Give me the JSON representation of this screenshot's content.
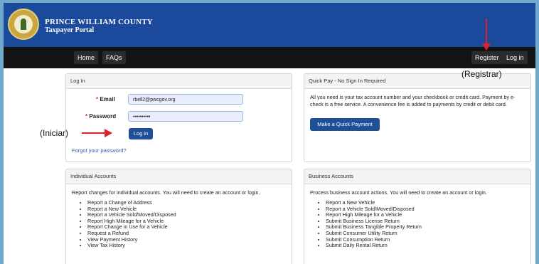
{
  "header": {
    "title_line1": "PRINCE WILLIAM COUNTY",
    "title_line2": "Taxpayer Portal"
  },
  "nav": {
    "home": "Home",
    "faqs": "FAQs",
    "register": "Register",
    "login": "Log in"
  },
  "login_panel": {
    "title": "Log In",
    "email_label": "Email",
    "email_value": "rbell2@pwcgov.org",
    "password_label": "Password",
    "password_value": "••••••••••",
    "login_button": "Log in",
    "forgot_link": "Forgot your password?"
  },
  "quickpay_panel": {
    "title": "Quick Pay - No Sign In Required",
    "description": "All you need is your tax account number and your checkbook or credit card. Payment by e-check is a free service. A convenience fee is added to payments by credit or debit card.",
    "button": "Make a Quick Payment"
  },
  "individual_panel": {
    "title": "Individual Accounts",
    "intro": "Report changes for individual accounts. You will need to create an account or login.",
    "items": [
      "Report a Change of Address",
      "Report a New Vehicle",
      "Report a Vehicle Sold/Moved/Disposed",
      "Report High Mileage for a Vehicle",
      "Report Change in Use for a Vehicle",
      "Request a Refund",
      "View Payment History",
      "View Tax History"
    ]
  },
  "business_panel": {
    "title": "Business Accounts",
    "intro": "Process business account actions. You will need to create an account or login.",
    "items": [
      "Report a New Vehicle",
      "Report a Vehicle Sold/Moved/Disposed",
      "Report High Mileage for a Vehicle",
      "Submit Business License Return",
      "Submit Business Tangible Property Return",
      "Submit Consumer Utility Return",
      "Submit Consumption Return",
      "Submit Daily Rental Return"
    ]
  },
  "annotations": {
    "register_note": "(Registrar)",
    "login_note": "(Iniciar)",
    "arrow_color": "#d9232a"
  }
}
